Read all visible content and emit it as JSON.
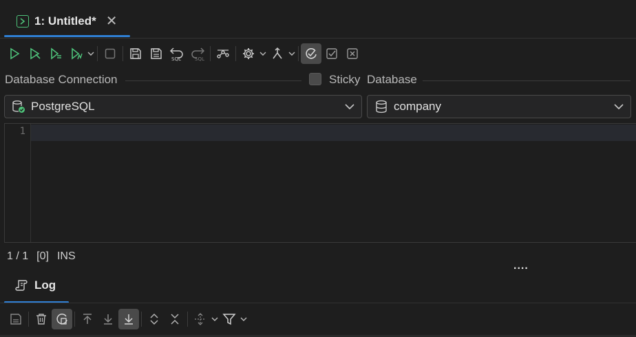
{
  "tab": {
    "title": "1: Untitled*",
    "close": "✕"
  },
  "connection": {
    "label": "Database Connection",
    "sticky_label": "Sticky",
    "database_label": "Database",
    "connection_value": "PostgreSQL",
    "database_value": "company"
  },
  "editor": {
    "line_number": "1"
  },
  "status": {
    "position": "1 / 1",
    "count": "[0]",
    "mode": "INS"
  },
  "splitter": {
    "handle": "...."
  },
  "log": {
    "title": "Log"
  },
  "colors": {
    "accent": "#2f7fd3",
    "run_green": "#4ec27a",
    "icon_gray": "#b4b4b4"
  }
}
